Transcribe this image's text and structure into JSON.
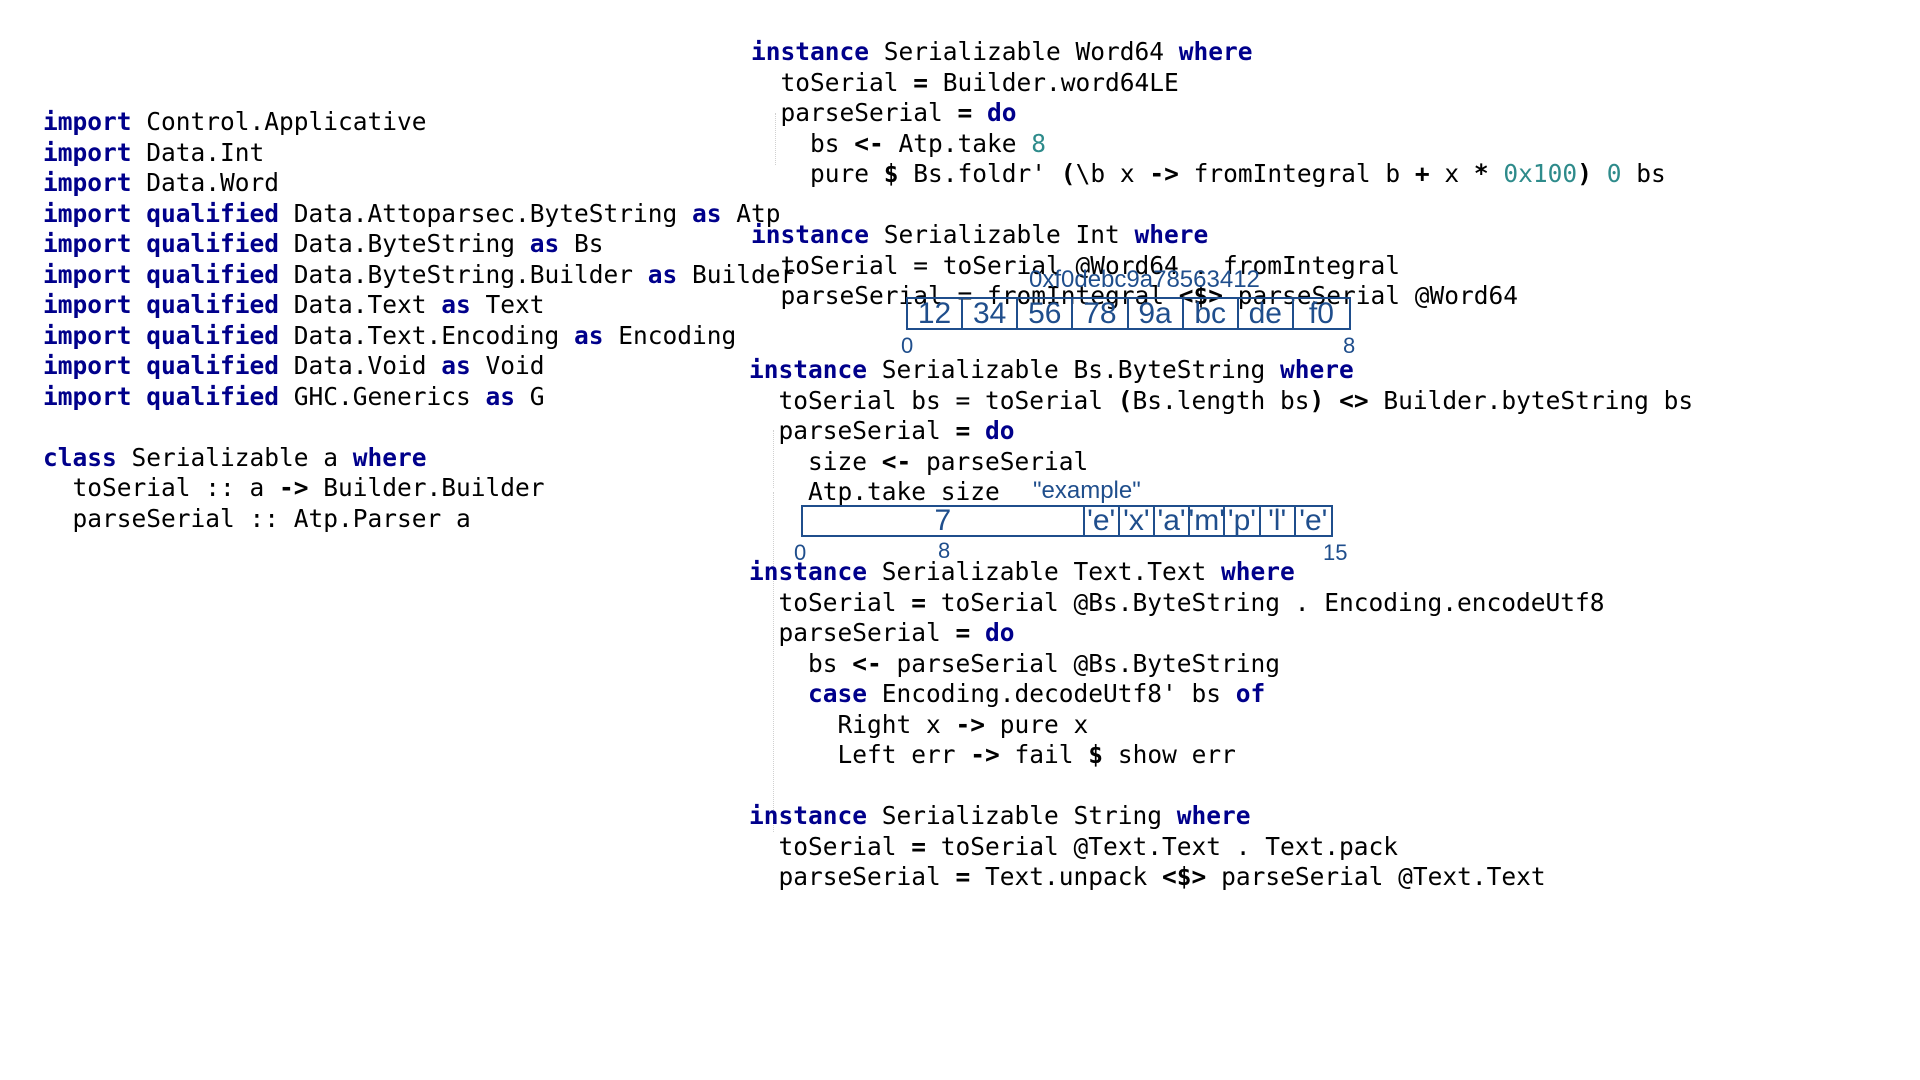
{
  "left_code": [
    [
      [
        "kw",
        "import"
      ],
      [
        "t",
        " Control.Applicative"
      ]
    ],
    [
      [
        "kw",
        "import"
      ],
      [
        "t",
        " Data.Int"
      ]
    ],
    [
      [
        "kw",
        "import"
      ],
      [
        "t",
        " Data.Word"
      ]
    ],
    [
      [
        "kw",
        "import qualified"
      ],
      [
        "t",
        " Data.Attoparsec.ByteString "
      ],
      [
        "kw",
        "as"
      ],
      [
        "t",
        " Atp"
      ]
    ],
    [
      [
        "kw",
        "import qualified"
      ],
      [
        "t",
        " Data.ByteString "
      ],
      [
        "kw",
        "as"
      ],
      [
        "t",
        " Bs"
      ]
    ],
    [
      [
        "kw",
        "import qualified"
      ],
      [
        "t",
        " Data.ByteString.Builder "
      ],
      [
        "kw",
        "as"
      ],
      [
        "t",
        " Builder"
      ]
    ],
    [
      [
        "kw",
        "import qualified"
      ],
      [
        "t",
        " Data.Text "
      ],
      [
        "kw",
        "as"
      ],
      [
        "t",
        " Text"
      ]
    ],
    [
      [
        "kw",
        "import qualified"
      ],
      [
        "t",
        " Data.Text.Encoding "
      ],
      [
        "kw",
        "as"
      ],
      [
        "t",
        " Encoding"
      ]
    ],
    [
      [
        "kw",
        "import qualified"
      ],
      [
        "t",
        " Data.Void "
      ],
      [
        "kw",
        "as"
      ],
      [
        "t",
        " Void"
      ]
    ],
    [
      [
        "kw",
        "import qualified"
      ],
      [
        "t",
        " GHC.Generics "
      ],
      [
        "kw",
        "as"
      ],
      [
        "t",
        " G"
      ]
    ],
    [],
    [
      [
        "kw",
        "class"
      ],
      [
        "t",
        " Serializable a "
      ],
      [
        "kw",
        "where"
      ]
    ],
    [
      [
        "t",
        "  toSerial :: a "
      ],
      [
        "op",
        "->"
      ],
      [
        "t",
        " Builder.Builder"
      ]
    ],
    [
      [
        "t",
        "  parseSerial :: Atp.Parser a"
      ]
    ]
  ],
  "code_word64_int": [
    [
      [
        "kw",
        "instance"
      ],
      [
        "t",
        " Serializable Word64 "
      ],
      [
        "kw",
        "where"
      ]
    ],
    [
      [
        "t",
        "  toSerial "
      ],
      [
        "op",
        "="
      ],
      [
        "t",
        " Builder.word64LE"
      ]
    ],
    [
      [
        "t",
        "  parseSerial "
      ],
      [
        "op",
        "="
      ],
      [
        "t",
        " "
      ],
      [
        "kw",
        "do"
      ]
    ],
    [
      [
        "t",
        "    bs "
      ],
      [
        "op",
        "<-"
      ],
      [
        "t",
        " Atp.take "
      ],
      [
        "num",
        "8"
      ]
    ],
    [
      [
        "t",
        "    pure "
      ],
      [
        "op",
        "$"
      ],
      [
        "t",
        " Bs.foldr' "
      ],
      [
        "op",
        "("
      ],
      [
        "t",
        "\\b x "
      ],
      [
        "op",
        "->"
      ],
      [
        "t",
        " fromIntegral b "
      ],
      [
        "op",
        "+"
      ],
      [
        "t",
        " x "
      ],
      [
        "op",
        "*"
      ],
      [
        "t",
        " "
      ],
      [
        "num",
        "0x100"
      ],
      [
        "op",
        ")"
      ],
      [
        "t",
        " "
      ],
      [
        "num",
        "0"
      ],
      [
        "t",
        " bs"
      ]
    ],
    [],
    [
      [
        "kw",
        "instance"
      ],
      [
        "t",
        " Serializable Int "
      ],
      [
        "kw",
        "where"
      ]
    ],
    [
      [
        "t",
        "  toSerial = toSerial @Word64 . fromIntegral"
      ]
    ],
    [
      [
        "t",
        "  parseSerial = fromIntegral "
      ],
      [
        "op",
        "<$>"
      ],
      [
        "t",
        " parseSerial @Word64"
      ]
    ]
  ],
  "code_bytestring": [
    [
      [
        "kw",
        "instance"
      ],
      [
        "t",
        " Serializable Bs.ByteString "
      ],
      [
        "kw",
        "where"
      ]
    ],
    [
      [
        "t",
        "  toSerial bs = toSerial "
      ],
      [
        "op",
        "("
      ],
      [
        "t",
        "Bs.length bs"
      ],
      [
        "op",
        ")"
      ],
      [
        "t",
        " "
      ],
      [
        "op",
        "<>"
      ],
      [
        "t",
        " Builder.byteString bs"
      ]
    ],
    [
      [
        "t",
        "  parseSerial "
      ],
      [
        "op",
        "="
      ],
      [
        "t",
        " "
      ],
      [
        "kw",
        "do"
      ]
    ],
    [
      [
        "t",
        "    size "
      ],
      [
        "op",
        "<-"
      ],
      [
        "t",
        " parseSerial"
      ]
    ],
    [
      [
        "t",
        "    Atp.take size"
      ]
    ]
  ],
  "code_text_string": [
    [
      [
        "kw",
        "instance"
      ],
      [
        "t",
        " Serializable Text.Text "
      ],
      [
        "kw",
        "where"
      ]
    ],
    [
      [
        "t",
        "  toSerial "
      ],
      [
        "op",
        "="
      ],
      [
        "t",
        " toSerial @Bs.ByteString . Encoding.encodeUtf8"
      ]
    ],
    [
      [
        "t",
        "  parseSerial "
      ],
      [
        "op",
        "="
      ],
      [
        "t",
        " "
      ],
      [
        "kw",
        "do"
      ]
    ],
    [
      [
        "t",
        "    bs "
      ],
      [
        "op",
        "<-"
      ],
      [
        "t",
        " parseSerial @Bs.ByteString"
      ]
    ],
    [
      [
        "t",
        "    "
      ],
      [
        "kw",
        "case"
      ],
      [
        "t",
        " Encoding.decodeUtf8' bs "
      ],
      [
        "kw",
        "of"
      ]
    ],
    [
      [
        "t",
        "      Right x "
      ],
      [
        "op",
        "->"
      ],
      [
        "t",
        " pure x"
      ]
    ],
    [
      [
        "t",
        "      Left err "
      ],
      [
        "op",
        "->"
      ],
      [
        "t",
        " fail "
      ],
      [
        "op",
        "$"
      ],
      [
        "t",
        " show err"
      ]
    ],
    [],
    [
      [
        "kw",
        "instance"
      ],
      [
        "t",
        " Serializable String "
      ],
      [
        "kw",
        "where"
      ]
    ],
    [
      [
        "t",
        "  toSerial "
      ],
      [
        "op",
        "="
      ],
      [
        "t",
        " toSerial @Text.Text . Text.pack"
      ]
    ],
    [
      [
        "t",
        "  parseSerial "
      ],
      [
        "op",
        "="
      ],
      [
        "t",
        " Text.unpack "
      ],
      [
        "op",
        "<$>"
      ],
      [
        "t",
        " parseSerial @Text.Text"
      ]
    ]
  ],
  "word64_diagram": {
    "title": "0xf0debc9a78563412",
    "bytes": [
      "12",
      "34",
      "56",
      "78",
      "9a",
      "bc",
      "de",
      "f0"
    ],
    "start_index": "0",
    "end_index": "8"
  },
  "bytestring_diagram": {
    "title": "\"example\"",
    "length_cell": "7",
    "chars": [
      "'e'",
      "'x'",
      "'a'",
      "'m'",
      "'p'",
      "'l'",
      "'e'"
    ],
    "start_index": "0",
    "mid_index": "8",
    "end_index": "15"
  },
  "colors": {
    "keyword": "#00008b",
    "number": "#2e8b8b",
    "diagram": "#1f4e8c"
  }
}
